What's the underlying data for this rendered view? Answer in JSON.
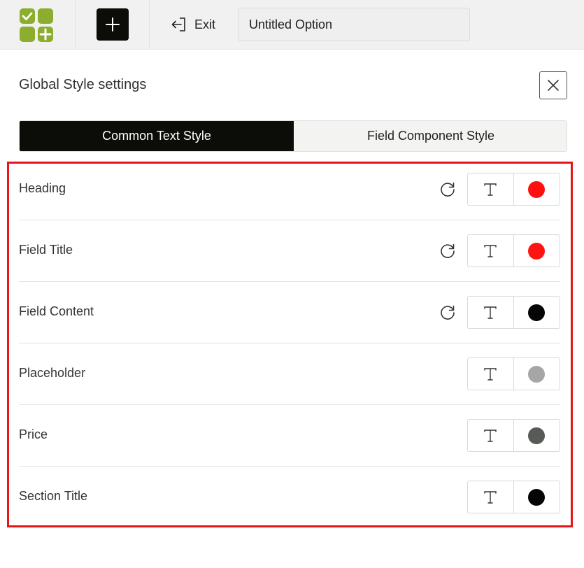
{
  "topbar": {
    "logo_colors": {
      "primary": "#8cad2e"
    },
    "add_icon": "plus-icon",
    "exit_label": "Exit",
    "exit_icon": "exit-icon",
    "title_value": "Untitled Option"
  },
  "panel": {
    "title": "Global Style settings",
    "close_icon": "close-icon"
  },
  "tabs": [
    {
      "label": "Common Text Style",
      "active": true
    },
    {
      "label": "Field Component Style",
      "active": false
    }
  ],
  "rows": [
    {
      "label": "Heading",
      "has_reset": true,
      "color": "#ff1010"
    },
    {
      "label": "Field Title",
      "has_reset": true,
      "color": "#ff1414"
    },
    {
      "label": "Field Content",
      "has_reset": true,
      "color": "#050505"
    },
    {
      "label": "Placeholder",
      "has_reset": false,
      "color": "#a6a6a6"
    },
    {
      "label": "Price",
      "has_reset": false,
      "color": "#585a57"
    },
    {
      "label": "Section Title",
      "has_reset": false,
      "color": "#050505"
    }
  ],
  "icons": {
    "reset": "reset-icon",
    "font": "font-icon"
  },
  "highlight_color": "#e8141a"
}
